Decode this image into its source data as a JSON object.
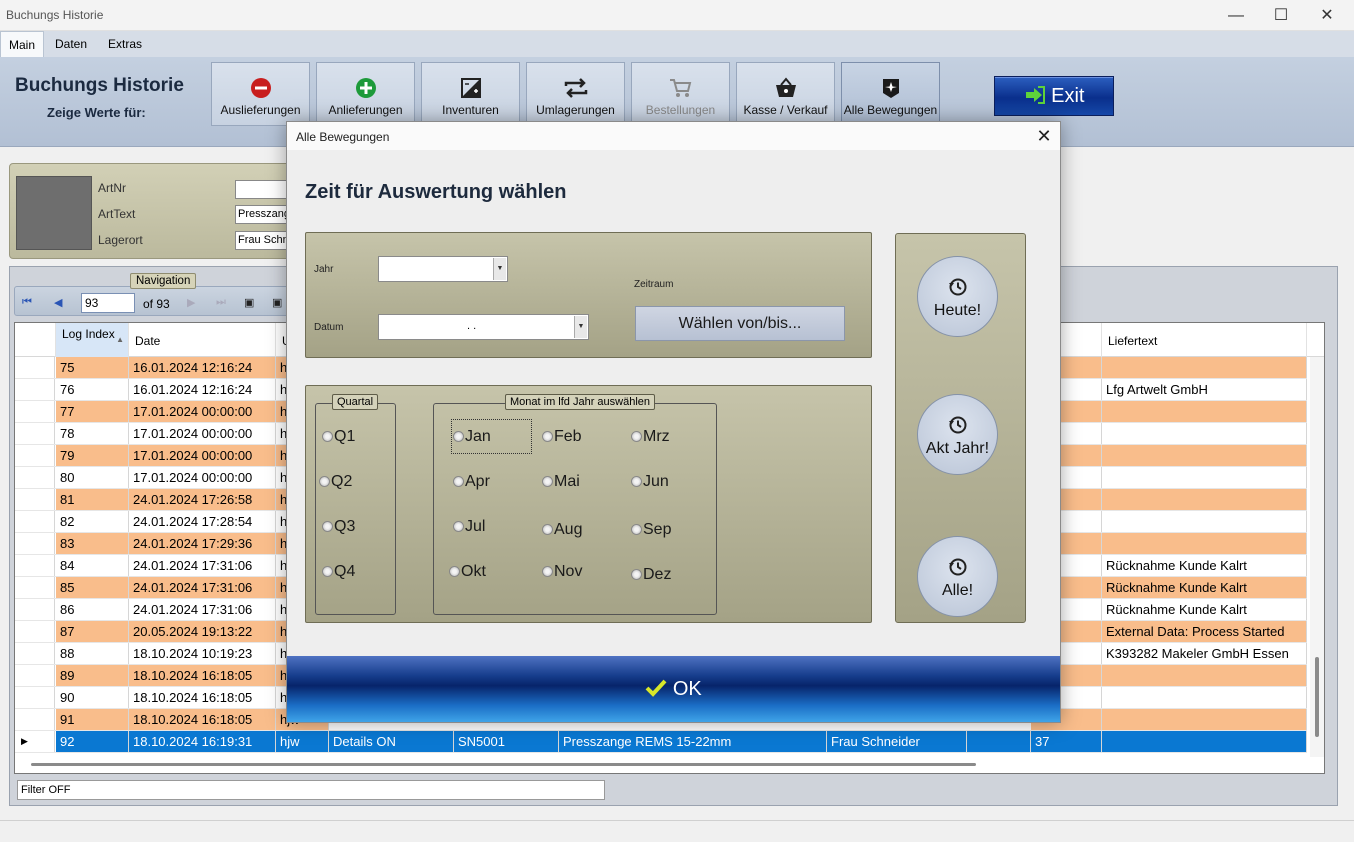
{
  "window": {
    "title": "Buchungs Historie",
    "minimize": "—",
    "maximize": "☐",
    "close": "✕"
  },
  "menu": [
    {
      "label": "Main"
    },
    {
      "label": "Daten"
    },
    {
      "label": "Extras"
    }
  ],
  "header": {
    "title": "Buchungs Historie",
    "subtitle": "Zeige Werte für:"
  },
  "toolbar": {
    "buttons": [
      {
        "label": "Auslieferungen",
        "icon": "minus-circle-icon",
        "color": "#c81e1e"
      },
      {
        "label": "Anlieferungen",
        "icon": "plus-circle-icon",
        "color": "#1d9a3a"
      },
      {
        "label": "Inventuren",
        "icon": "inventory-icon"
      },
      {
        "label": "Umlagerungen",
        "icon": "transfer-arrows-icon"
      },
      {
        "label": "Bestellungen",
        "icon": "cart-icon",
        "disabled": true
      },
      {
        "label": "Kasse / Verkauf",
        "icon": "basket-icon"
      },
      {
        "label": "Alle Bewegungen",
        "icon": "all-movements-icon",
        "selected": true
      }
    ],
    "exit_label": "Exit"
  },
  "article": {
    "artnr_label": "ArtNr",
    "artnr_value": "",
    "arttext_label": "ArtText",
    "arttext_value": "Presszange",
    "lagerort_label": "Lagerort",
    "lagerort_value": "Frau Schn"
  },
  "navigation": {
    "label": "Navigation",
    "position": "93",
    "of_text": "of 93"
  },
  "grid": {
    "columns": [
      "Log Index",
      "Date",
      "U",
      "and",
      "Liefertext"
    ],
    "rows": [
      {
        "idx": "75",
        "date": "16.01.2024 12:16:24",
        "u": "h",
        "liefertext": ""
      },
      {
        "idx": "76",
        "date": "16.01.2024 12:16:24",
        "u": "h",
        "liefertext": "Lfg Artwelt GmbH"
      },
      {
        "idx": "77",
        "date": "17.01.2024 00:00:00",
        "u": "h",
        "liefertext": ""
      },
      {
        "idx": "78",
        "date": "17.01.2024 00:00:00",
        "u": "h",
        "liefertext": ""
      },
      {
        "idx": "79",
        "date": "17.01.2024 00:00:00",
        "u": "h",
        "liefertext": ""
      },
      {
        "idx": "80",
        "date": "17.01.2024 00:00:00",
        "u": "h",
        "liefertext": ""
      },
      {
        "idx": "81",
        "date": "24.01.2024 17:26:58",
        "u": "h",
        "liefertext": ""
      },
      {
        "idx": "82",
        "date": "24.01.2024 17:28:54",
        "u": "h",
        "liefertext": ""
      },
      {
        "idx": "83",
        "date": "24.01.2024 17:29:36",
        "u": "h",
        "liefertext": ""
      },
      {
        "idx": "84",
        "date": "24.01.2024 17:31:06",
        "u": "h",
        "liefertext": "Rücknahme Kunde Kalrt"
      },
      {
        "idx": "85",
        "date": "24.01.2024 17:31:06",
        "u": "h",
        "liefertext": "Rücknahme Kunde Kalrt"
      },
      {
        "idx": "86",
        "date": "24.01.2024 17:31:06",
        "u": "h",
        "liefertext": "Rücknahme Kunde Kalrt"
      },
      {
        "idx": "87",
        "date": "20.05.2024 19:13:22",
        "u": "h",
        "liefertext": "External Data: Process Started"
      },
      {
        "idx": "88",
        "date": "18.10.2024 10:19:23",
        "u": "h",
        "liefertext": "K393282 Makeler GmbH Essen"
      },
      {
        "idx": "89",
        "date": "18.10.2024 16:18:05",
        "u": "h",
        "liefertext": ""
      },
      {
        "idx": "90",
        "date": "18.10.2024 16:18:05",
        "u": "h",
        "liefertext": ""
      },
      {
        "idx": "91",
        "date": "18.10.2024 16:18:05",
        "u": "hjw",
        "liefertext": ""
      }
    ],
    "selected_row": {
      "idx": "92",
      "date": "18.10.2024 16:19:31",
      "user": "hjw",
      "action": "Details ON",
      "sn": "SN5001",
      "arttext": "Presszange REMS 15-22mm",
      "lagerort": "Frau Schneider",
      "bestand": "37"
    }
  },
  "filter": "Filter OFF",
  "dialog": {
    "title": "Alle Bewegungen",
    "close": "✕",
    "heading": "Zeit für Auswertung wählen",
    "jahr_label": "Jahr",
    "datum_label": "Datum",
    "datum_value": ". .",
    "zeitraum_label": "Zeitraum",
    "range_button": "Wählen von/bis...",
    "quartal_title": "Quartal",
    "quarters": [
      "Q1",
      "Q2",
      "Q3",
      "Q4"
    ],
    "monat_title": "Monat im lfd Jahr auswählen",
    "months": [
      "Jan",
      "Feb",
      "Mrz",
      "Apr",
      "Mai",
      "Jun",
      "Jul",
      "Aug",
      "Sep",
      "Okt",
      "Nov",
      "Dez"
    ],
    "heute_label": "Heute!",
    "akt_jahr_label": "Akt Jahr!",
    "alle_label": "Alle!",
    "ok_label": "OK"
  }
}
